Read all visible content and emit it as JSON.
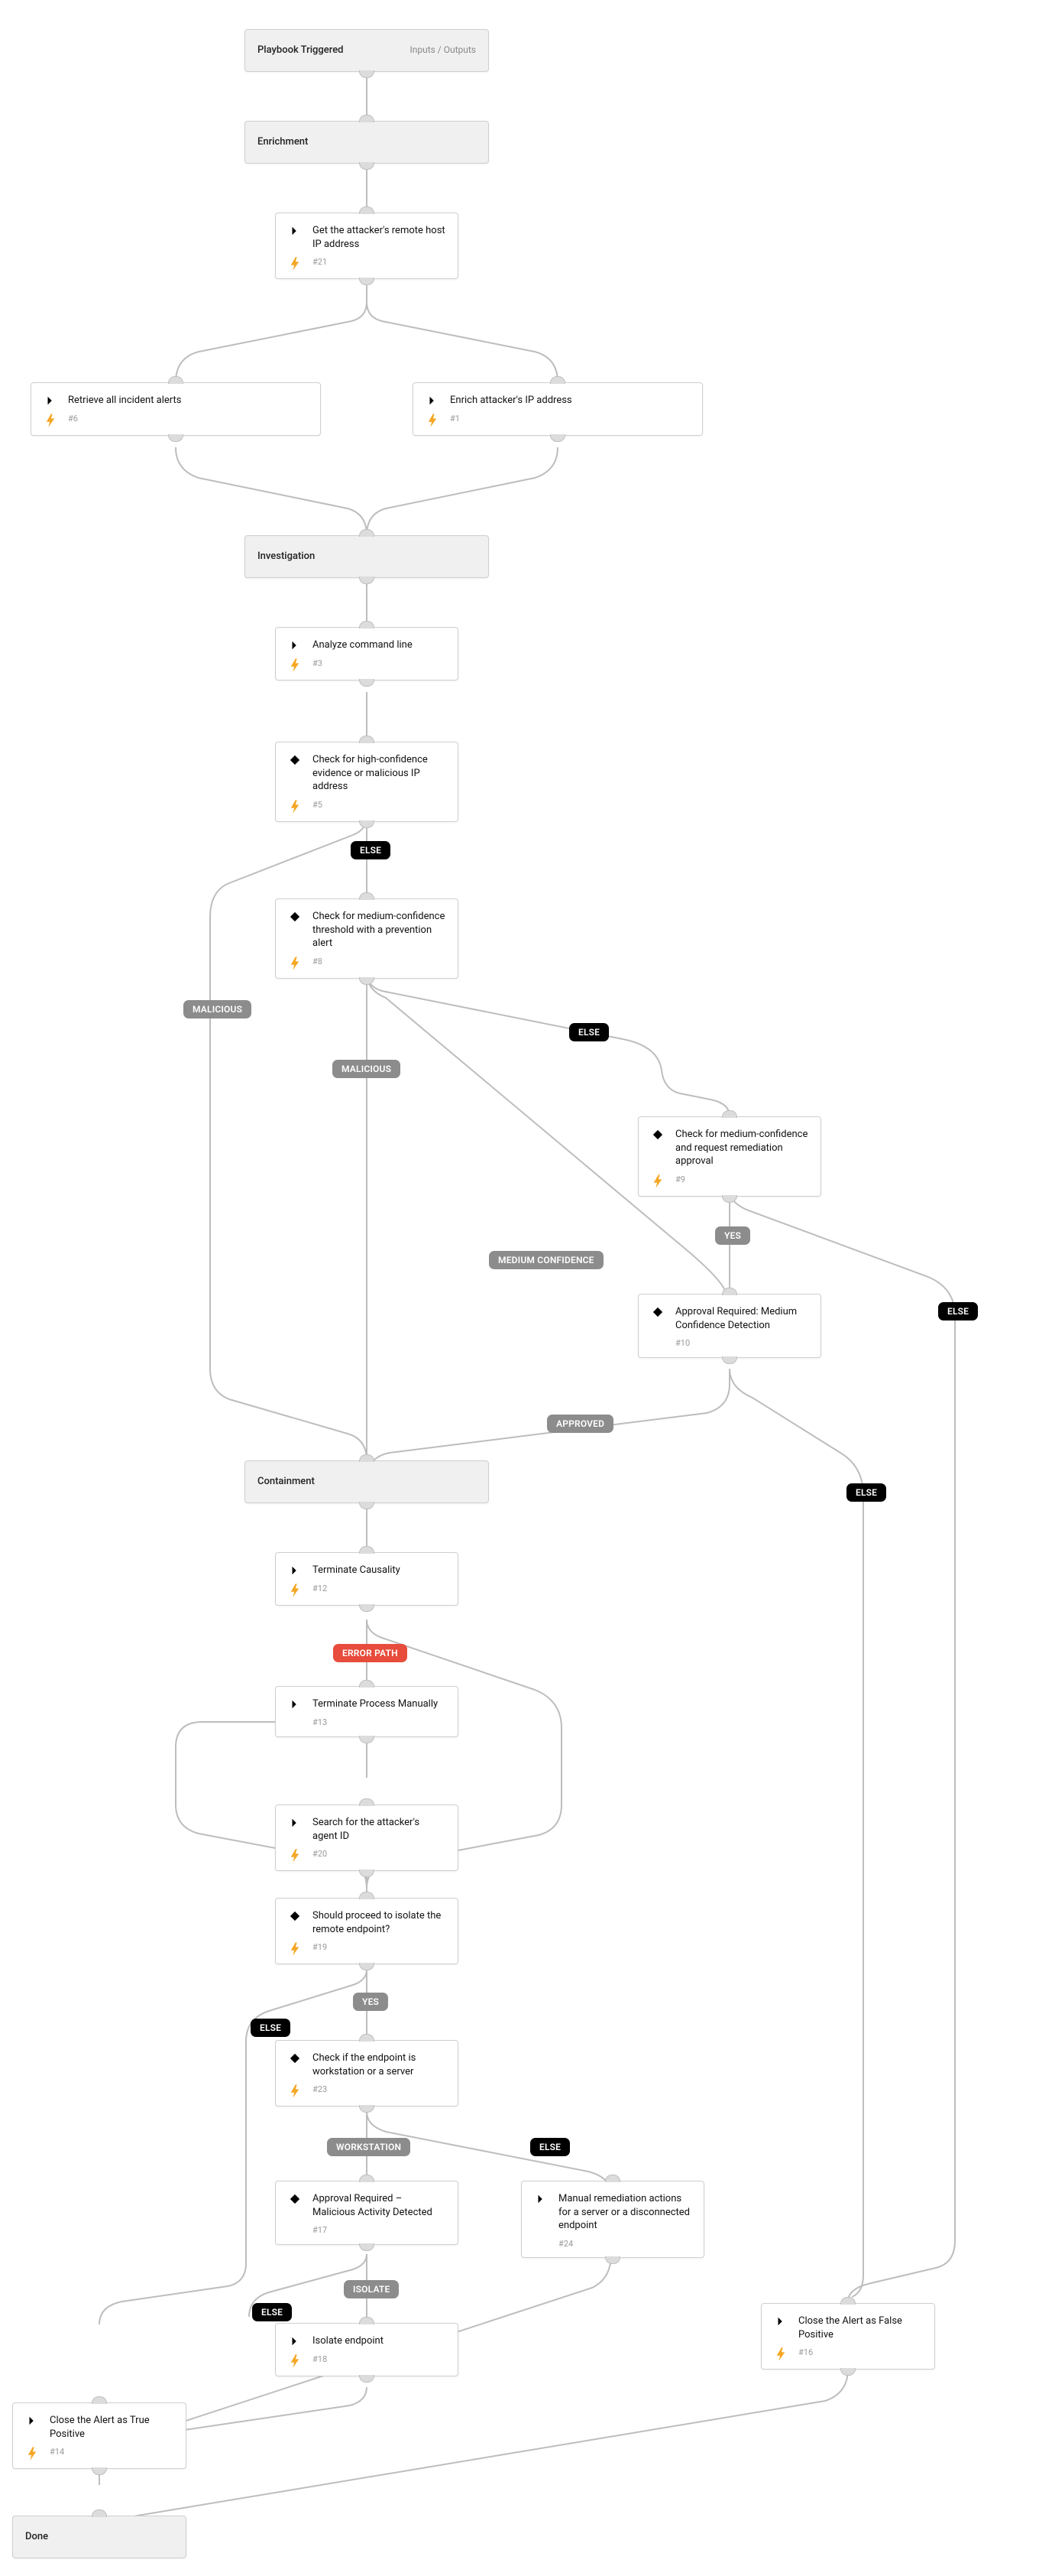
{
  "diagram": {
    "triggered": {
      "title": "Playbook Triggered",
      "sub": "Inputs / Outputs"
    },
    "enrichment": {
      "title": "Enrichment"
    },
    "investigation": {
      "title": "Investigation"
    },
    "containment": {
      "title": "Containment"
    },
    "done": {
      "title": "Done"
    },
    "get_remote_host": {
      "title": "Get the attacker's remote host IP address",
      "id": "#21"
    },
    "retrieve_alerts": {
      "title": "Retrieve all incident alerts",
      "id": "#6"
    },
    "enrich_ip": {
      "title": "Enrich attacker's IP address",
      "id": "#1"
    },
    "analyze_cmd": {
      "title": "Analyze command line",
      "id": "#3"
    },
    "check_high": {
      "title": "Check for high-confidence evidence or malicious IP address",
      "id": "#5"
    },
    "check_medium": {
      "title": "Check for medium-confidence threshold with a prevention alert",
      "id": "#8"
    },
    "check_medium2": {
      "title": "Check for medium-confidence and request remediation approval",
      "id": "#9"
    },
    "approval_medium": {
      "title": "Approval Required: Medium Confidence Detection",
      "id": "#10"
    },
    "terminate_caus": {
      "title": "Terminate Causality",
      "id": "#12"
    },
    "terminate_man": {
      "title": "Terminate Process Manually",
      "id": "#13"
    },
    "search_agent": {
      "title": "Search for the attacker's agent ID",
      "id": "#20"
    },
    "proceed_isolate": {
      "title": "Should proceed to isolate the remote endpoint?",
      "id": "#19"
    },
    "check_ws_server": {
      "title": "Check if the endpoint is workstation or a server",
      "id": "#23"
    },
    "approval_mal": {
      "title": "Approval Required – Malicious Activity Detected",
      "id": "#17"
    },
    "manual_rem": {
      "title": "Manual remediation actions for a server or a disconnected endpoint",
      "id": "#24"
    },
    "isolate_ep": {
      "title": "Isolate endpoint",
      "id": "#18"
    },
    "close_tp": {
      "title": "Close the Alert as True Positive",
      "id": "#14"
    },
    "close_fp": {
      "title": "Close the Alert as False Positive",
      "id": "#16"
    }
  },
  "labels": {
    "else": "ELSE",
    "yes": "YES",
    "malicious": "MALICIOUS",
    "medium_confidence": "MEDIUM CONFIDENCE",
    "approved": "APPROVED",
    "error_path": "ERROR PATH",
    "workstation": "WORKSTATION",
    "isolate": "ISOLATE"
  }
}
